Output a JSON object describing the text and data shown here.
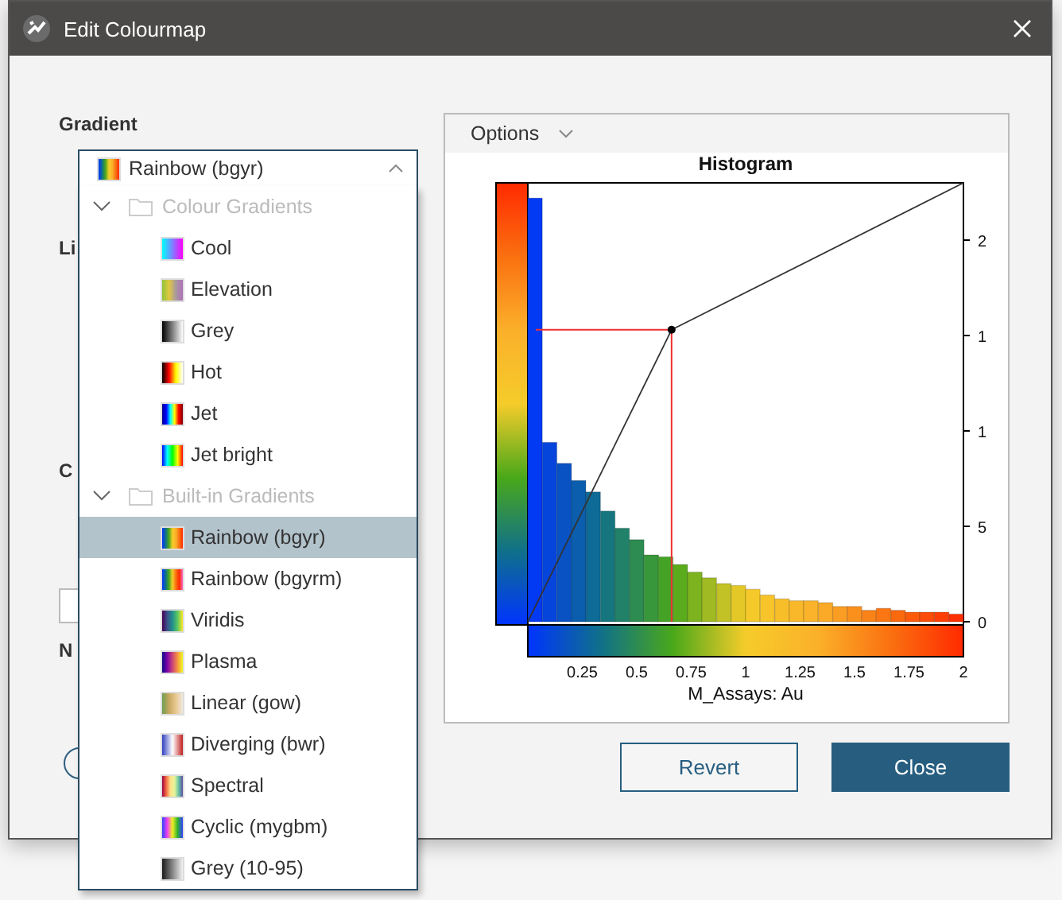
{
  "window": {
    "title": "Edit Colourmap"
  },
  "form": {
    "gradient_label": "Gradient",
    "hidden_labels": [
      "Li",
      "C",
      "N"
    ]
  },
  "gradient_combo": {
    "value": "Rainbow (bgyr)",
    "expanded": true,
    "kind": "rainbow"
  },
  "gradient_tree": [
    {
      "label": "Colour Gradients",
      "expanded": true,
      "disabled": true,
      "children": [
        {
          "label": "Cool",
          "selected": false,
          "kind": "cool"
        },
        {
          "label": "Elevation",
          "selected": false,
          "kind": "elevation"
        },
        {
          "label": "Grey",
          "selected": false,
          "kind": "grey"
        },
        {
          "label": "Hot",
          "selected": false,
          "kind": "hot"
        },
        {
          "label": "Jet",
          "selected": false,
          "kind": "jet"
        },
        {
          "label": "Jet bright",
          "selected": false,
          "kind": "jetbright"
        }
      ]
    },
    {
      "label": "Built-in Gradients",
      "expanded": true,
      "disabled": true,
      "children": [
        {
          "label": "Rainbow (bgyr)",
          "selected": true,
          "kind": "rainbow"
        },
        {
          "label": "Rainbow (bgyrm)",
          "selected": false,
          "kind": "rainbowm"
        },
        {
          "label": "Viridis",
          "selected": false,
          "kind": "viridis"
        },
        {
          "label": "Plasma",
          "selected": false,
          "kind": "plasma"
        },
        {
          "label": "Linear (gow)",
          "selected": false,
          "kind": "gow"
        },
        {
          "label": "Diverging (bwr)",
          "selected": false,
          "kind": "bwr"
        },
        {
          "label": "Spectral",
          "selected": false,
          "kind": "spectral"
        },
        {
          "label": "Cyclic (mygbm)",
          "selected": false,
          "kind": "cyclic"
        },
        {
          "label": "Grey (10-95)",
          "selected": false,
          "kind": "grey1095"
        }
      ]
    }
  ],
  "histogram_panel": {
    "options_label": "Options",
    "cut_tick_labels": [
      "2",
      "1",
      "1"
    ],
    "chart_data": {
      "type": "bar",
      "title": "Histogram",
      "xlabel": "M_Assays: Au",
      "xlim": [
        0,
        2
      ],
      "ylim": [
        0,
        23
      ],
      "xticks": [
        0.25,
        0.5,
        0.75,
        1,
        1.25,
        1.5,
        1.75,
        2
      ],
      "yticks": [
        0,
        5
      ],
      "x": [
        0.033,
        0.1,
        0.167,
        0.233,
        0.3,
        0.367,
        0.433,
        0.5,
        0.567,
        0.633,
        0.7,
        0.767,
        0.833,
        0.9,
        0.967,
        1.033,
        1.1,
        1.167,
        1.233,
        1.3,
        1.367,
        1.433,
        1.5,
        1.567,
        1.633,
        1.7,
        1.767,
        1.833,
        1.9,
        1.967
      ],
      "values": [
        22.2,
        9.4,
        8.3,
        7.4,
        6.8,
        5.8,
        4.9,
        4.3,
        3.5,
        3.4,
        3.0,
        2.6,
        2.3,
        2.0,
        1.9,
        1.7,
        1.4,
        1.2,
        1.1,
        1.1,
        1.0,
        0.8,
        0.8,
        0.6,
        0.7,
        0.6,
        0.5,
        0.5,
        0.5,
        0.4
      ]
    }
  },
  "buttons": [
    {
      "label": "Revert",
      "primary": false
    },
    {
      "label": "Close",
      "primary": true
    }
  ]
}
